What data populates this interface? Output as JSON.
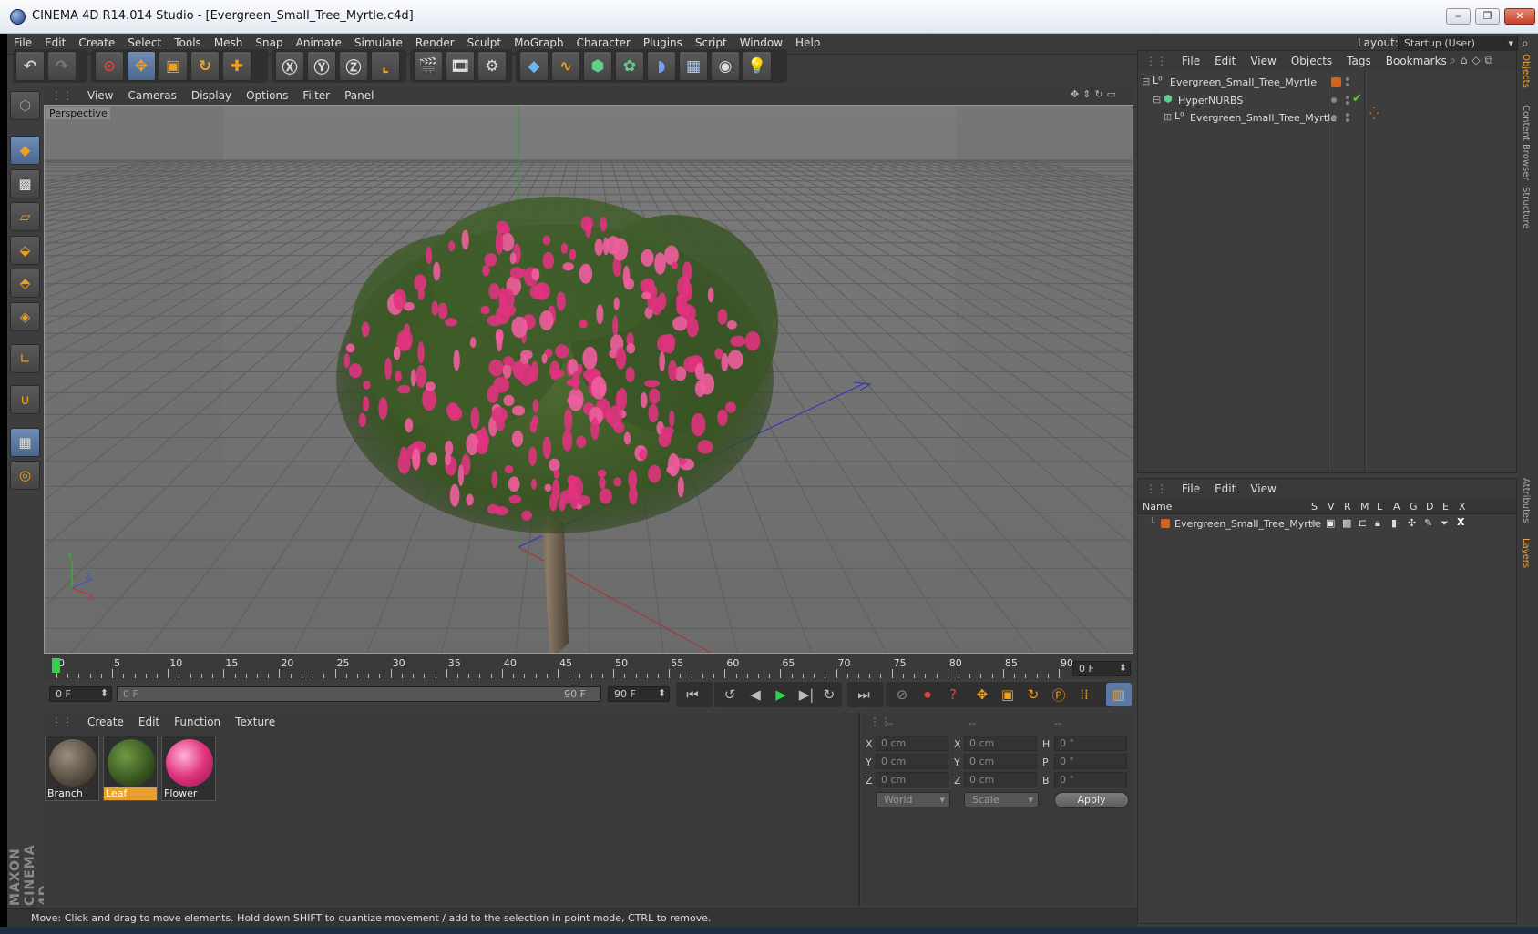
{
  "window": {
    "title": "CINEMA 4D R14.014 Studio - [Evergreen_Small_Tree_Myrtle.c4d]",
    "min": "‒",
    "max": "❐",
    "close": "✕"
  },
  "menu": [
    "File",
    "Edit",
    "Create",
    "Select",
    "Tools",
    "Mesh",
    "Snap",
    "Animate",
    "Simulate",
    "Render",
    "Sculpt",
    "MoGraph",
    "Character",
    "Plugins",
    "Script",
    "Window",
    "Help"
  ],
  "layout": {
    "label": "Layout:",
    "value": "Startup (User)"
  },
  "viewport": {
    "menu": [
      "View",
      "Cameras",
      "Display",
      "Options",
      "Filter",
      "Panel"
    ],
    "label": "Perspective",
    "axis": {
      "y": "Y",
      "z": "Z",
      "x": "X"
    }
  },
  "timeline": {
    "ticks": [
      "0",
      "5",
      "10",
      "15",
      "20",
      "25",
      "30",
      "35",
      "40",
      "45",
      "50",
      "55",
      "60",
      "65",
      "70",
      "75",
      "80",
      "85",
      "90"
    ],
    "frame_field": "0 F",
    "start_field": "0 F",
    "range_start": "0 F",
    "range_end": "90 F",
    "end_field": "90 F"
  },
  "materials": {
    "menu": [
      "Create",
      "Edit",
      "Function",
      "Texture"
    ],
    "items": [
      {
        "name": "Branch",
        "selected": false
      },
      {
        "name": "Leaf",
        "selected": true
      },
      {
        "name": "Flower",
        "selected": false
      }
    ]
  },
  "coords": {
    "headers": [
      "--",
      "--",
      "--"
    ],
    "rows": [
      {
        "a": "X",
        "av": "0 cm",
        "b": "X",
        "bv": "0 cm",
        "c": "H",
        "cv": "0 °"
      },
      {
        "a": "Y",
        "av": "0 cm",
        "b": "Y",
        "bv": "0 cm",
        "c": "P",
        "cv": "0 °"
      },
      {
        "a": "Z",
        "av": "0 cm",
        "b": "Z",
        "bv": "0 cm",
        "c": "B",
        "cv": "0 °"
      }
    ],
    "space": "World",
    "mode": "Scale",
    "apply": "Apply"
  },
  "status": "Move: Click and drag to move elements. Hold down SHIFT to quantize movement / add to the selection in point mode, CTRL to remove.",
  "objects": {
    "menu": [
      "File",
      "Edit",
      "View",
      "Objects",
      "Tags",
      "Bookmarks"
    ],
    "items": [
      {
        "name": "Evergreen_Small_Tree_Myrtle"
      },
      {
        "name": "HyperNURBS"
      },
      {
        "name": "Evergreen_Small_Tree_Myrtle"
      }
    ]
  },
  "layers": {
    "menu": [
      "File",
      "Edit",
      "View"
    ],
    "columns": [
      "Name",
      "S",
      "V",
      "R",
      "M",
      "L",
      "A",
      "G",
      "D",
      "E",
      "X"
    ],
    "items": [
      {
        "name": "Evergreen_Small_Tree_Myrtle"
      }
    ]
  },
  "side_tabs": [
    "Objects",
    "Content Browser",
    "Structure",
    "Attributes",
    "Layers"
  ],
  "branding": "MAXON CINEMA 4D",
  "colors": {
    "accent": "#e8a030",
    "flower": "#e0337e",
    "foliage": "#3d5a28"
  }
}
